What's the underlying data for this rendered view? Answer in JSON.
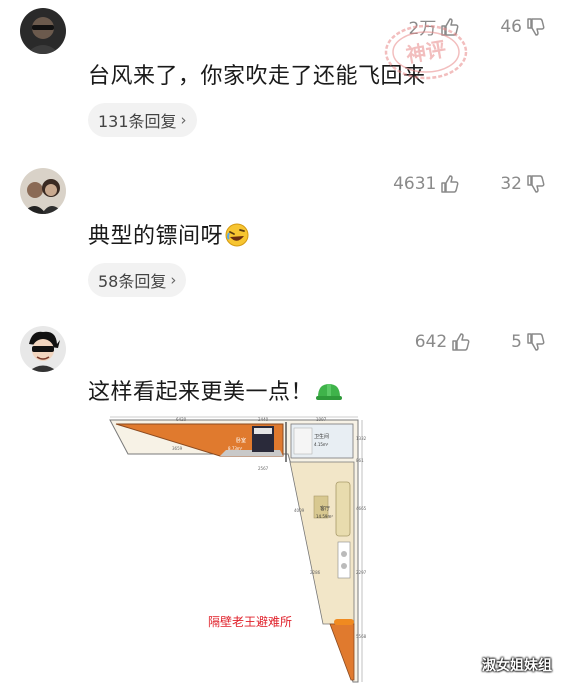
{
  "comments": [
    {
      "likes": "2万",
      "dislikes": "46",
      "text": "台风来了，你家吹走了还能飞回来",
      "replies": "131条回复",
      "avatar": "avatar-dark-glasses-man"
    },
    {
      "likes": "4631",
      "dislikes": "32",
      "text": "典型的镖间呀",
      "replies": "58条回复",
      "avatar": "avatar-couple-photo",
      "emoji": "rolling-laughing-emoji"
    },
    {
      "likes": "642",
      "dislikes": "5",
      "text": "这样看起来更美一点！",
      "avatar": "avatar-cartoon-sunglasses",
      "emoji": "green-hard-hat-emoji"
    }
  ],
  "floorplan": {
    "caption": "隔壁老王避难所",
    "bedroom_label": "卧室",
    "bedroom_area": "8.73m²",
    "bathroom_label": "卫生间",
    "bathroom_area": "4.15m²",
    "living_label": "客厅",
    "living_area": "14.59m²",
    "dims": [
      "6420",
      "2440",
      "1097",
      "3659",
      "2567",
      "4009",
      "2286",
      "1332",
      "861",
      "4665",
      "2297",
      "5568"
    ]
  },
  "watermark": "淑女姐妹组",
  "stamp_text": "神评",
  "colors": {
    "accent_stamp": "#e98a8a",
    "text": "#1a1a1a",
    "meta": "#8a8a8a",
    "reply_bg": "#f2f2f2",
    "floor_orange": "#e07a2e",
    "floor_beige": "#f2e6c8"
  }
}
